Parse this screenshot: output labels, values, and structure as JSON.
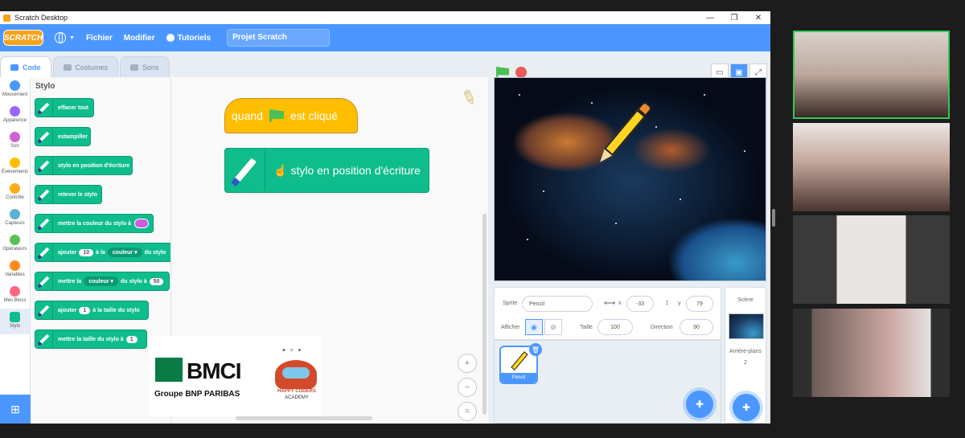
{
  "window": {
    "title": "Scratch Desktop"
  },
  "menubar": {
    "logo": "SCRATCH",
    "file": "Fichier",
    "edit": "Modifier",
    "tutorials": "Tutoriels",
    "project_title": "Projet Scratch"
  },
  "tabs": [
    {
      "label": "Code"
    },
    {
      "label": "Costumes"
    },
    {
      "label": "Sons"
    }
  ],
  "categories": [
    {
      "label": "Mouvement",
      "color": "#4c97ff"
    },
    {
      "label": "Apparence",
      "color": "#9966ff"
    },
    {
      "label": "Son",
      "color": "#cf63cf"
    },
    {
      "label": "Événements",
      "color": "#ffbf00"
    },
    {
      "label": "Contrôle",
      "color": "#ffab19"
    },
    {
      "label": "Capteurs",
      "color": "#5cb1d6"
    },
    {
      "label": "Opérateurs",
      "color": "#59c059"
    },
    {
      "label": "Variables",
      "color": "#ff8c1a"
    },
    {
      "label": "Mes Blocs",
      "color": "#ff6680"
    },
    {
      "label": "Stylo",
      "color": "#0fbd8c"
    }
  ],
  "palette": {
    "title": "Stylo",
    "blocks": {
      "clear": "effacer tout",
      "stamp": "estampiller",
      "pen_down": "stylo en position d'écriture",
      "pen_up": "relever le stylo",
      "set_color": "mettre la couleur du stylo à",
      "change_a": "ajouter",
      "change_value": "10",
      "change_b": "à la",
      "change_dd": "couleur",
      "change_c": "du stylo",
      "set_param_a": "mettre la",
      "set_param_dd": "couleur",
      "set_param_b": "du stylo à",
      "set_param_value": "50",
      "change_size_a": "ajouter",
      "change_size_value": "1",
      "change_size_b": "à la taille du stylo",
      "set_size": "mettre la taille du stylo à",
      "set_size_value": "1"
    }
  },
  "script": {
    "hat_a": "quand",
    "hat_b": "est cliqué",
    "block": "stylo en position d'écriture"
  },
  "sponsor": {
    "bank": "BMCI",
    "group": "Groupe BNP PARIBAS",
    "academy_a": "HAPPY CODERS",
    "academy_b": "ACADEMY"
  },
  "sprite_info": {
    "sprite_label": "Sprite",
    "sprite_name": "Pencil",
    "x_label": "x",
    "x": "-33",
    "y_label": "y",
    "y": "79",
    "show_label": "Afficher",
    "size_label": "Taille",
    "size": "100",
    "direction_label": "Direction",
    "direction": "90"
  },
  "sprites": [
    {
      "name": "Pencil"
    }
  ],
  "scene": {
    "title": "Scène",
    "backdrops_label": "Arrière-plans",
    "backdrops_count": "2"
  },
  "icons": {
    "green_flag": "#4cbf56",
    "stop": "#ec5959",
    "accent": "#4c97ff",
    "pen_block": "#0fbd8c"
  }
}
